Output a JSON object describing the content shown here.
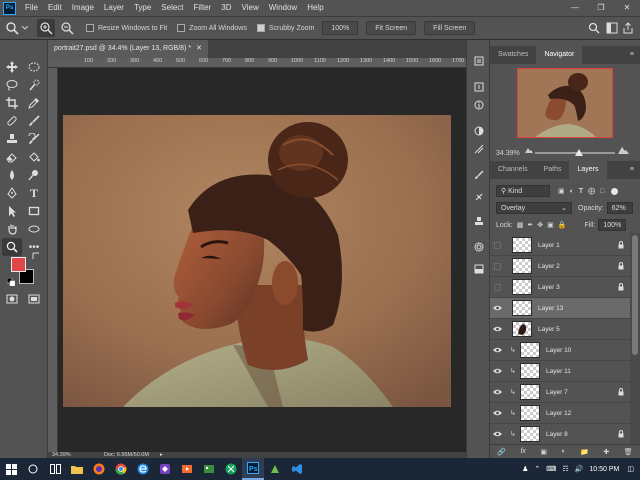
{
  "menubar": {
    "logo": "Ps",
    "items": [
      "File",
      "Edit",
      "Image",
      "Layer",
      "Type",
      "Select",
      "Filter",
      "3D",
      "View",
      "Window",
      "Help"
    ]
  },
  "options": {
    "resize_windows": "Resize Windows to Fit",
    "zoom_all": "Zoom All Windows",
    "scrubby_zoom": "Scrubby Zoom",
    "zoom_value": "100%",
    "fit_screen": "Fit Screen",
    "fill_screen": "Fill Screen"
  },
  "document": {
    "tab_title": "portrait27.psd @ 34.4% (Layer 13, RGB/8) *",
    "ruler_labels": [
      "100",
      "200",
      "300",
      "400",
      "500",
      "600",
      "700",
      "800",
      "900",
      "1000",
      "1100",
      "1200",
      "1300",
      "1400",
      "1500",
      "1600",
      "1700"
    ],
    "zoom_status": "34.39%",
    "doc_size": "Doc: 6.95M/50.0M"
  },
  "colors": {
    "foreground": "#e04848",
    "background": "#000000",
    "accent": "#e0403b"
  },
  "navigator": {
    "tabs": [
      "Swatches",
      "Navigator"
    ],
    "active_tab": "Navigator",
    "zoom": "34.39%",
    "zoom_fraction": 0.55
  },
  "layers_panel": {
    "tabs": [
      "Channels",
      "Paths",
      "Layers"
    ],
    "active_tab": "Layers",
    "filter_kind": "Kind",
    "blend_mode": "Overlay",
    "opacity_label": "Opacity:",
    "opacity_value": "62%",
    "lock_label": "Lock:",
    "fill_label": "Fill:",
    "fill_value": "100%",
    "layers": [
      {
        "name": "Layer 1",
        "visible": false,
        "locked": true,
        "clipped": false,
        "selected": false
      },
      {
        "name": "Layer 2",
        "visible": false,
        "locked": true,
        "clipped": false,
        "selected": false
      },
      {
        "name": "Layer 3",
        "visible": false,
        "locked": true,
        "clipped": false,
        "selected": false
      },
      {
        "name": "Layer 13",
        "visible": true,
        "locked": false,
        "clipped": false,
        "selected": true
      },
      {
        "name": "Layer 5",
        "visible": true,
        "locked": false,
        "clipped": false,
        "selected": false
      },
      {
        "name": "Layer 10",
        "visible": true,
        "locked": false,
        "clipped": true,
        "selected": false
      },
      {
        "name": "Layer 11",
        "visible": true,
        "locked": false,
        "clipped": true,
        "selected": false
      },
      {
        "name": "Layer 7",
        "visible": true,
        "locked": true,
        "clipped": true,
        "selected": false
      },
      {
        "name": "Layer 12",
        "visible": true,
        "locked": false,
        "clipped": true,
        "selected": false
      },
      {
        "name": "Layer 8",
        "visible": true,
        "locked": true,
        "clipped": true,
        "selected": false
      }
    ]
  },
  "taskbar": {
    "time": "10:50 PM"
  }
}
